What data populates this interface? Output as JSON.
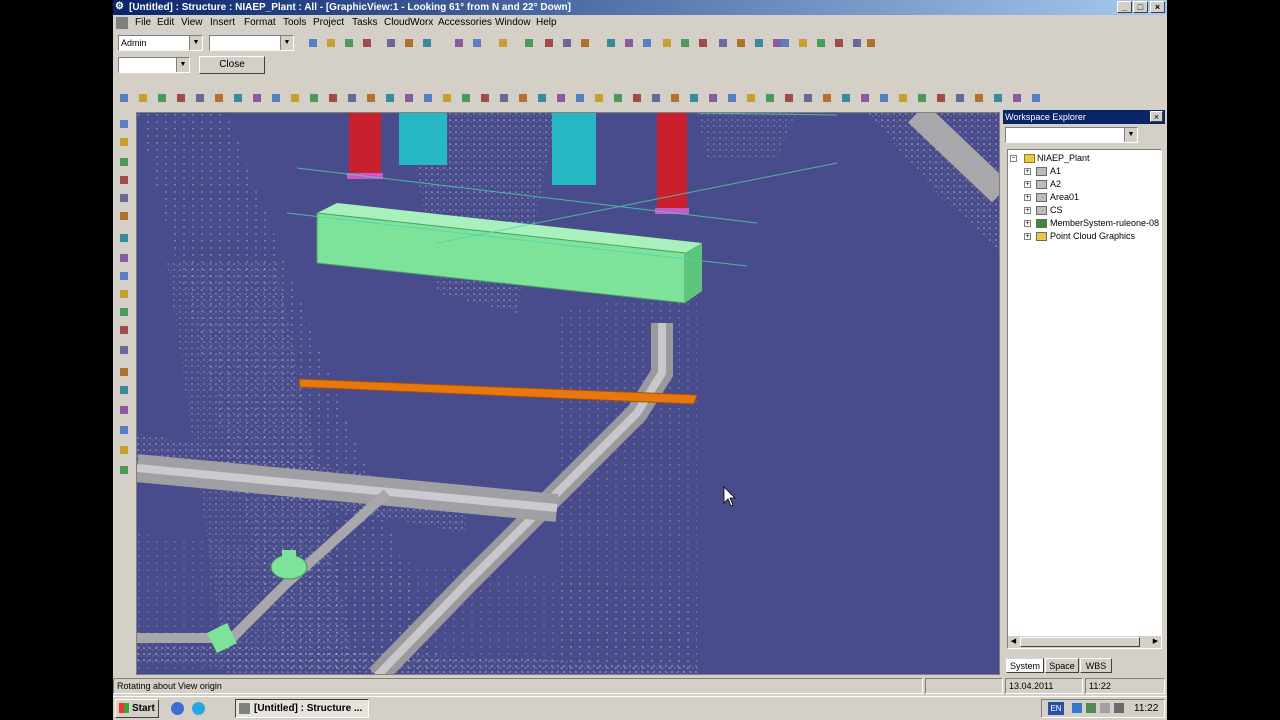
{
  "window": {
    "title": "[Untitled] : Structure : NIAEP_Plant : All - [GraphicView:1 - Looking 61° from N and 22° Down]",
    "minimize": "_",
    "maximize": "□",
    "close": "×"
  },
  "menu": [
    "File",
    "Edit",
    "View",
    "Insert",
    "Format",
    "Tools",
    "Project",
    "Tasks",
    "CloudWorx",
    "Accessories",
    "Window",
    "Help"
  ],
  "toolbar": {
    "permission_group": "Admin",
    "filter_value": "",
    "secondary_value": "",
    "close_label": "Close"
  },
  "workspace_explorer": {
    "title": "Workspace Explorer",
    "filter_value": "",
    "root": "NIAEP_Plant",
    "items": [
      {
        "label": "A1",
        "icon": "system-icon"
      },
      {
        "label": "A2",
        "icon": "system-icon"
      },
      {
        "label": "Area01",
        "icon": "system-icon"
      },
      {
        "label": "CS",
        "icon": "coordinate-system-icon"
      },
      {
        "label": "MemberSystem-ruleone-08",
        "icon": "member-system-icon"
      },
      {
        "label": "Point Cloud Graphics",
        "icon": "folder-icon"
      }
    ],
    "tabs": [
      "System",
      "Space",
      "WBS"
    ],
    "active_tab": "System"
  },
  "status": {
    "message": "Rotating about View origin",
    "date": "13.04.2011",
    "time": "11:22"
  },
  "taskbar": {
    "start": "Start",
    "task": "[Untitled] : Structure ...",
    "language": "EN",
    "clock": "11:22"
  },
  "colors": {
    "viewport_bg": "#484b8c",
    "beam_green": "#7de39a",
    "beam_orange": "#e8780e",
    "column_red": "#c8202c",
    "column_cyan": "#27b8c4",
    "titlebar_start": "#0a246a",
    "titlebar_end": "#a6caf0"
  }
}
